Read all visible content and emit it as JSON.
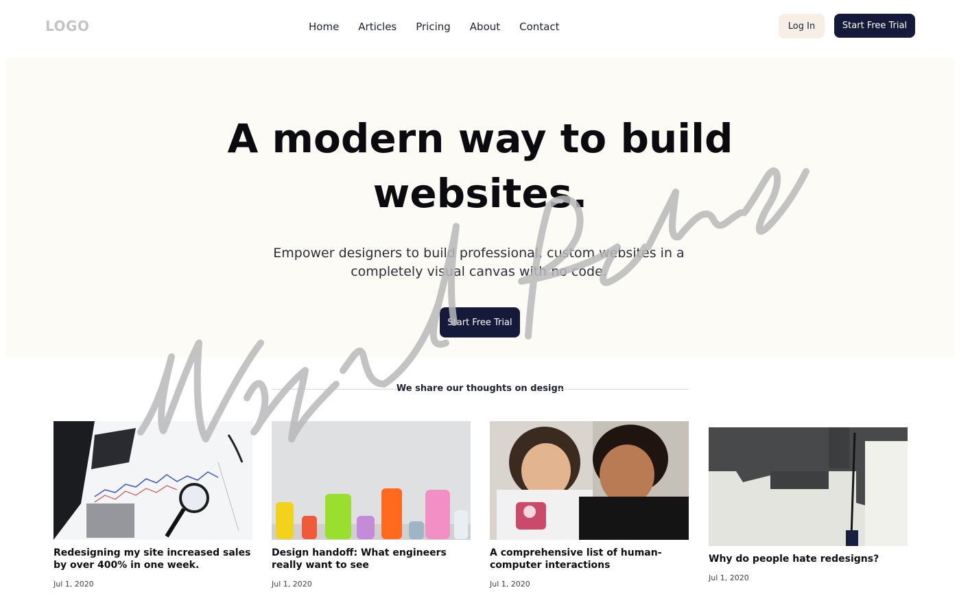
{
  "header": {
    "logo": "LOGO",
    "nav": [
      "Home",
      "Articles",
      "Pricing",
      "About",
      "Contact"
    ],
    "login_label": "Log In",
    "trial_label": "Start Free Trial"
  },
  "hero": {
    "title_line1": "A modern way to build",
    "title_line2": "websites.",
    "subtitle_line1": "Empower designers to build professional, custom websites in a",
    "subtitle_line2": "completely visual canvas with no code.",
    "cta_label": "Start Free Trial"
  },
  "section": {
    "heading": "We share our thoughts on design"
  },
  "articles": [
    {
      "title": "Redesigning my site increased sales by over 400% in one week.",
      "date": "Jul 1, 2020",
      "image_icon": "analytics-chart-photo"
    },
    {
      "title": "Design handoff: What engineers really want to see",
      "date": "Jul 1, 2020",
      "image_icon": "colorful-bottles-photo"
    },
    {
      "title": "A comprehensive list of human-computer interactions",
      "date": "Jul 1, 2020",
      "image_icon": "people-phone-photo"
    },
    {
      "title": "Why do people hate redesigns?",
      "date": "Jul 1, 2020",
      "image_icon": "paint-roller-photo"
    }
  ],
  "watermark": {
    "signature_text": "Miguel Ramos"
  },
  "colors": {
    "primary": "#151a3a",
    "hero_bg": "#fdfbf6",
    "login_bg": "#f7efe6",
    "logo": "#c2c4c9"
  }
}
